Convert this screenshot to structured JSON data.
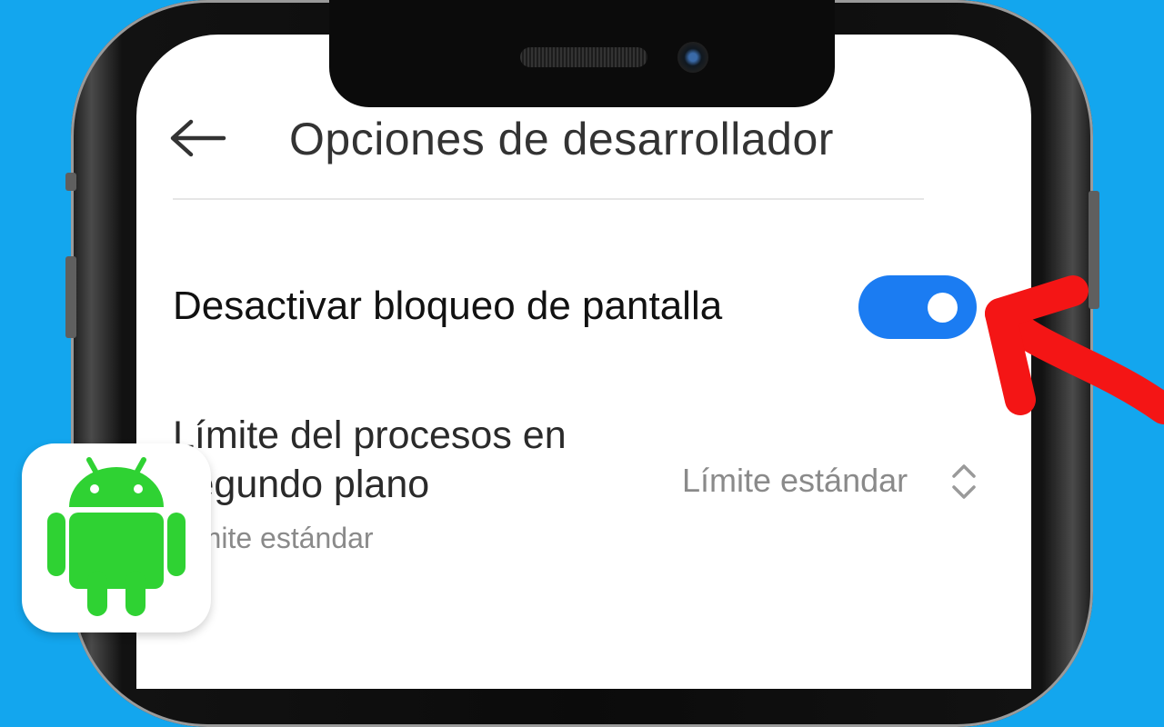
{
  "colors": {
    "background": "#13a6ee",
    "toggle_on": "#1b7cf2",
    "arrow": "#f41515",
    "android_green": "#2fd233"
  },
  "header": {
    "back_icon": "arrow-left-icon",
    "title": "Opciones de desarrollador"
  },
  "settings": {
    "disable_lock_screen": {
      "label": "Desactivar bloqueo de pantalla",
      "enabled": true
    },
    "background_process_limit": {
      "title": "Límite del procesos en segundo plano",
      "value": "Límite estándar",
      "subtitle": "Límite estándar",
      "icon": "chevron-up-down-icon"
    }
  },
  "overlay": {
    "app_icon": "android-logo-icon",
    "pointer": "red-curved-arrow-icon"
  }
}
